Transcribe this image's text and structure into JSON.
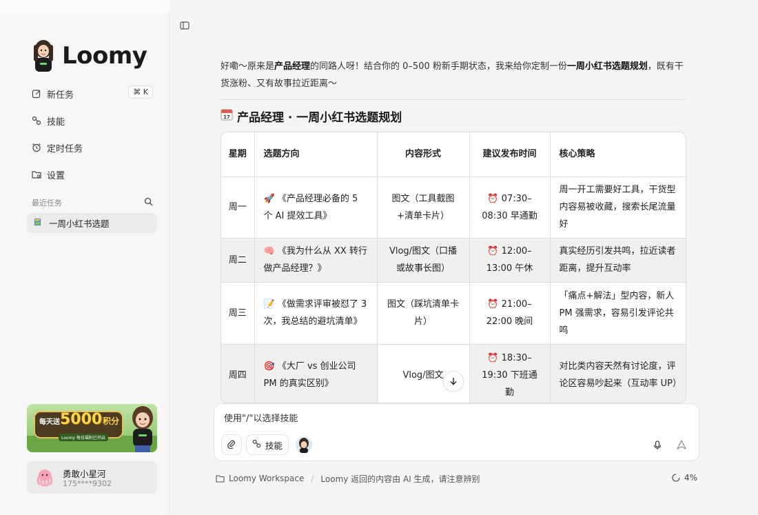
{
  "app": {
    "name": "Loomy"
  },
  "sidebar": {
    "nav": [
      {
        "label": "新任务",
        "shortcut": "⌘ K",
        "icon": "edit-icon"
      },
      {
        "label": "技能",
        "icon": "skill-icon"
      },
      {
        "label": "定时任务",
        "icon": "alarm-clock-icon"
      },
      {
        "label": "设置",
        "icon": "folder-gear-icon"
      }
    ],
    "recent_title": "最近任务",
    "recent_items": [
      {
        "label": "一周小红书选题"
      }
    ],
    "promo": {
      "prefix": "每天送",
      "amount": "5000",
      "unit": "积分",
      "sub": "Loomy 每日福利已开启"
    },
    "user": {
      "name": "勇敢小星河",
      "phone": "175****9302"
    }
  },
  "chat": {
    "intro_parts": [
      "好嘞～原来是",
      "产品经理",
      "的同路人呀！结合你的 0–500 粉新手期状态，我来给你定制一份",
      "一周小红书选题规划",
      "，既有干货涨粉、又有故事拉近距离～"
    ],
    "section_title": "产品经理 · 一周小红书选题规划",
    "table": {
      "headers": [
        "星期",
        "选题方向",
        "内容形式",
        "建议发布时间",
        "核心策略"
      ],
      "rows": [
        {
          "day": "周一",
          "emoji": "🚀",
          "topic": "《产品经理必备的 5 个 AI 提效工具》",
          "format": "图文（工具截图+清单卡片）",
          "time": "⏰ 07:30–08:30 早通勤",
          "strategy": "周一开工需要好工具，干货型内容易被收藏，搜索长尾流量好"
        },
        {
          "day": "周二",
          "emoji": "🧠",
          "topic": "《我为什么从 XX 转行做产品经理？》",
          "format": "Vlog/图文（口播或故事长图）",
          "time": "⏰ 12:00–13:00 午休",
          "strategy": "真实经历引发共鸣，拉近读者距离，提升互动率"
        },
        {
          "day": "周三",
          "emoji": "📝",
          "topic": "《做需求评审被怼了 3 次，我总结的避坑清单》",
          "format": "图文（踩坑清单卡片）",
          "time": "⏰ 21:00–22:00 晚间",
          "strategy": "「痛点+解法」型内容，新人 PM 强需求，容易引发评论共鸣"
        },
        {
          "day": "周四",
          "emoji": "🎯",
          "topic": "《大厂 vs 创业公司 PM 的真实区别》",
          "format": "Vlog/图文",
          "time": "⏰ 18:30–19:30 下班通勤",
          "strategy": "对比类内容天然有讨论度，评论区容易吵起来（互动率 UP）"
        }
      ]
    }
  },
  "composer": {
    "placeholder": "使用\"/\"以选择技能",
    "skill_label": "技能"
  },
  "footer": {
    "workspace": "Loomy Workspace",
    "disclaimer": "Loomy 返回的内容由 AI 生成，请注意辨别",
    "progress": "4%"
  }
}
